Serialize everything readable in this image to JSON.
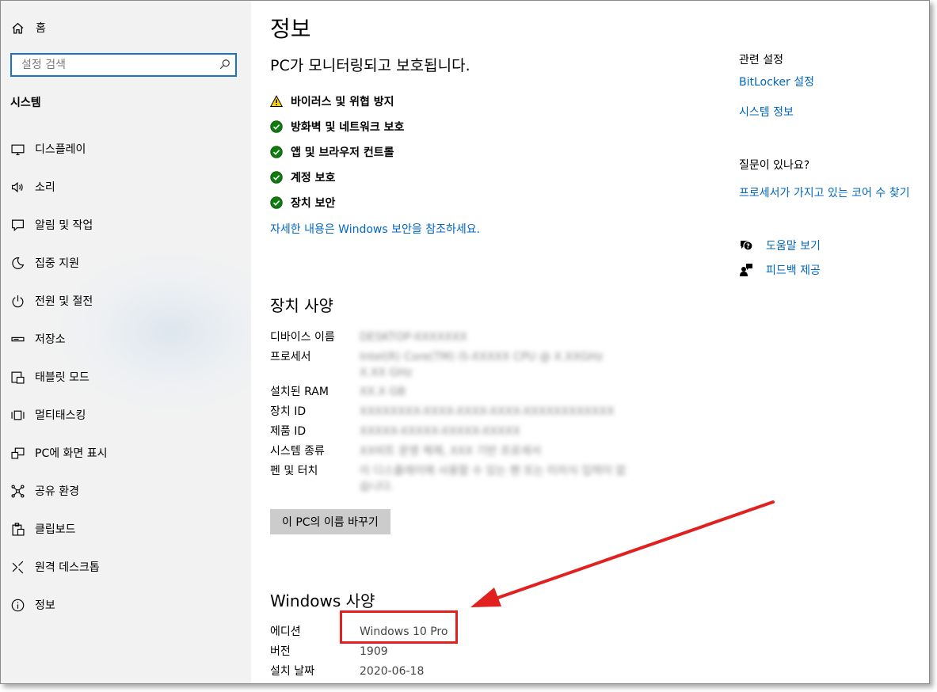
{
  "sidebar": {
    "home_label": "홈",
    "search_placeholder": "설정 검색",
    "section_title": "시스템",
    "items": [
      {
        "label": "디스플레이",
        "icon": "monitor-icon"
      },
      {
        "label": "소리",
        "icon": "speaker-icon"
      },
      {
        "label": "알림 및 작업",
        "icon": "message-icon"
      },
      {
        "label": "집중 지원",
        "icon": "moon-icon"
      },
      {
        "label": "전원 및 절전",
        "icon": "power-icon"
      },
      {
        "label": "저장소",
        "icon": "storage-icon"
      },
      {
        "label": "태블릿 모드",
        "icon": "tablet-icon"
      },
      {
        "label": "멀티태스킹",
        "icon": "multitask-icon"
      },
      {
        "label": "PC에 화면 표시",
        "icon": "project-icon"
      },
      {
        "label": "공유 환경",
        "icon": "share-icon"
      },
      {
        "label": "클립보드",
        "icon": "clipboard-icon"
      },
      {
        "label": "원격 데스크톱",
        "icon": "remote-icon"
      },
      {
        "label": "정보",
        "icon": "info-icon"
      }
    ]
  },
  "main": {
    "title": "정보",
    "status_heading": "PC가 모니터링되고 보호됩니다.",
    "security": [
      {
        "label": "바이러스 및 위협 방지",
        "status": "warning"
      },
      {
        "label": "방화벽 및 네트워크 보호",
        "status": "ok"
      },
      {
        "label": "앱 및 브라우저 컨트롤",
        "status": "ok"
      },
      {
        "label": "계정 보호",
        "status": "ok"
      },
      {
        "label": "장치 보안",
        "status": "ok"
      }
    ],
    "security_link": "자세한 내용은 Windows 보안을 참조하세요.",
    "device_specs": {
      "heading": "장치 사양",
      "labels": {
        "device_name": "디바이스 이름",
        "processor": "프로세서",
        "ram": "설치된 RAM",
        "device_id": "장치 ID",
        "product_id": "제품 ID",
        "system_type": "시스템 종류",
        "pen_touch": "펜 및 터치"
      },
      "rename_button": "이 PC의 이름 바꾸기"
    },
    "windows_specs": {
      "heading": "Windows 사양",
      "labels": {
        "edition": "에디션",
        "version": "버전",
        "install_date": "설치 날짜"
      },
      "values": {
        "edition": "Windows 10 Pro",
        "version": "1909",
        "install_date": "2020-06-18"
      }
    }
  },
  "right_panel": {
    "related_title": "관련 설정",
    "bitlocker_link": "BitLocker 설정",
    "system_info_link": "시스템 정보",
    "question_title": "질문이 있나요?",
    "cores_link": "프로세서가 가지고 있는 코어 수 찾기",
    "help_label": "도움말 보기",
    "feedback_label": "피드백 제공"
  },
  "colors": {
    "accent": "#0067c0",
    "search_border": "#1a73c8",
    "ok_green": "#107c10",
    "warning_yellow": "#fcd116",
    "annotation_red": "#e0211f",
    "sidebar_bg": "#f2f2f2",
    "button_bg": "#cccccc"
  }
}
